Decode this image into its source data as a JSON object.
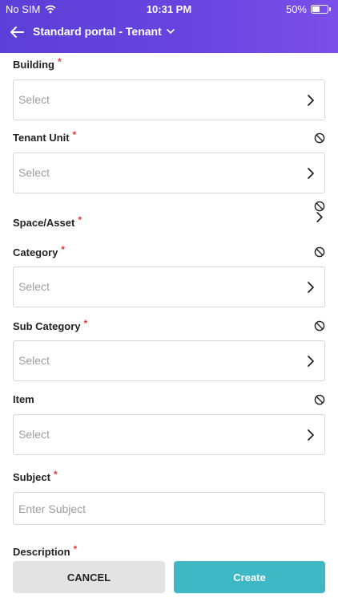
{
  "status_bar": {
    "carrier": "No SIM",
    "time": "10:31 PM",
    "battery": "50%",
    "battery_level": 0.5
  },
  "header": {
    "title": "Standard portal - Tenant"
  },
  "form": {
    "building": {
      "label": "Building",
      "placeholder": "Select"
    },
    "tenant_unit": {
      "label": "Tenant Unit",
      "placeholder": "Select"
    },
    "space_asset": {
      "label": "Space/Asset"
    },
    "category": {
      "label": "Category",
      "placeholder": "Select"
    },
    "sub_category": {
      "label": "Sub Category",
      "placeholder": "Select"
    },
    "item": {
      "label": "Item",
      "placeholder": "Select"
    },
    "subject": {
      "label": "Subject",
      "placeholder": "Enter Subject"
    },
    "description": {
      "label": "Description"
    },
    "required_marker": "*"
  },
  "footer": {
    "cancel_label": "CANCEL",
    "create_label": "Create"
  },
  "colors": {
    "header": "#5b3fd6",
    "required": "#e53935",
    "create_button": "#3fb8c6",
    "cancel_button": "#e3e3e3"
  }
}
